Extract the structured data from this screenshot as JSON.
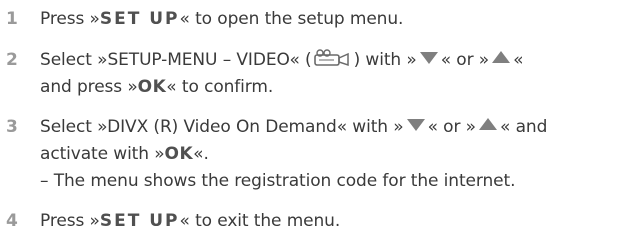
{
  "steps": [
    {
      "number": "1",
      "line1": {
        "pre": "Press »",
        "key": "SET UP",
        "post": "« to open the setup menu."
      }
    },
    {
      "number": "2",
      "line1": {
        "pre": "Select »SETUP-MENU – VIDEO« (",
        "mid": ") with »",
        "or": "« or »",
        "end": "«"
      },
      "line2": {
        "pre": "and press »",
        "key": "OK",
        "post": "« to confirm."
      }
    },
    {
      "number": "3",
      "line1": {
        "pre": "Select »DIVX (R) Video On Demand« with »",
        "or": "« or »",
        "end": "« and"
      },
      "line2": {
        "pre": "activate with »",
        "key": "OK",
        "post": "«."
      },
      "line3": "– The menu shows the registration code for the internet."
    },
    {
      "number": "4",
      "line1": {
        "pre": "Press »",
        "key": "SET UP",
        "post": "« to exit the menu."
      }
    }
  ],
  "icons": {
    "video": "video-camera-icon",
    "down": "down-arrow-icon",
    "up": "up-arrow-icon"
  },
  "colors": {
    "text": "#3a3a3a",
    "number": "#9a9a9a",
    "arrow": "#7f7f7f"
  }
}
